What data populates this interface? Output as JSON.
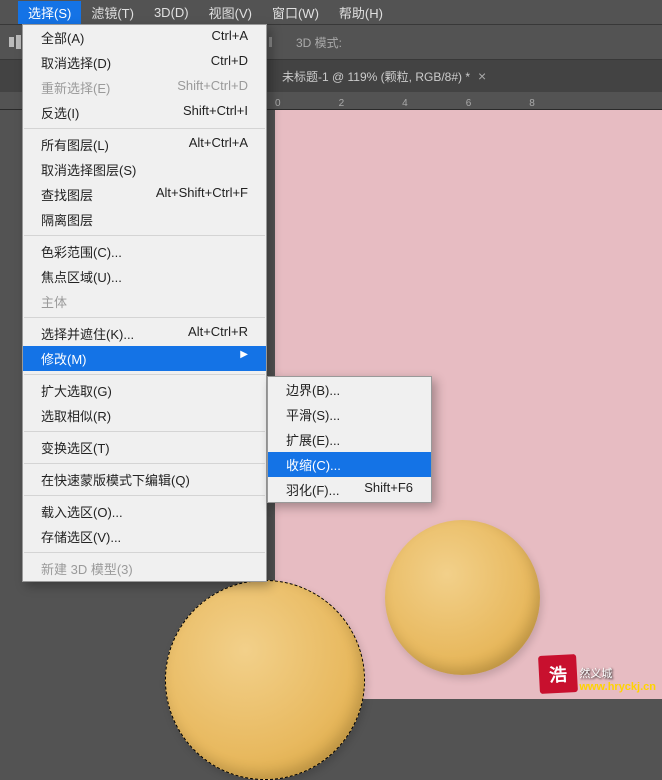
{
  "menubar": {
    "items": [
      "选择(S)",
      "滤镜(T)",
      "3D(D)",
      "视图(V)",
      "窗口(W)",
      "帮助(H)"
    ]
  },
  "toolbar": {
    "mode_label": "3D 模式:"
  },
  "tab": {
    "title": "未标题-1 @ 119% (颗粒, RGB/8#) *"
  },
  "ruler": {
    "marks": [
      "0",
      "2",
      "4",
      "6",
      "8"
    ]
  },
  "dropdown": {
    "all": {
      "label": "全部(A)",
      "shortcut": "Ctrl+A"
    },
    "deselect": {
      "label": "取消选择(D)",
      "shortcut": "Ctrl+D"
    },
    "reselect": {
      "label": "重新选择(E)",
      "shortcut": "Shift+Ctrl+D"
    },
    "inverse": {
      "label": "反选(I)",
      "shortcut": "Shift+Ctrl+I"
    },
    "all_layers": {
      "label": "所有图层(L)",
      "shortcut": "Alt+Ctrl+A"
    },
    "deselect_layers": {
      "label": "取消选择图层(S)",
      "shortcut": ""
    },
    "find_layers": {
      "label": "查找图层",
      "shortcut": "Alt+Shift+Ctrl+F"
    },
    "isolate_layers": {
      "label": "隔离图层",
      "shortcut": ""
    },
    "color_range": {
      "label": "色彩范围(C)...",
      "shortcut": ""
    },
    "focus_area": {
      "label": "焦点区域(U)...",
      "shortcut": ""
    },
    "subject": {
      "label": "主体",
      "shortcut": ""
    },
    "select_mask": {
      "label": "选择并遮住(K)...",
      "shortcut": "Alt+Ctrl+R"
    },
    "modify": {
      "label": "修改(M)",
      "shortcut": ""
    },
    "grow": {
      "label": "扩大选取(G)",
      "shortcut": ""
    },
    "similar": {
      "label": "选取相似(R)",
      "shortcut": ""
    },
    "transform": {
      "label": "变换选区(T)",
      "shortcut": ""
    },
    "quickmask": {
      "label": "在快速蒙版模式下编辑(Q)",
      "shortcut": ""
    },
    "load": {
      "label": "载入选区(O)...",
      "shortcut": ""
    },
    "save": {
      "label": "存储选区(V)...",
      "shortcut": ""
    },
    "new3d": {
      "label": "新建 3D 模型(3)",
      "shortcut": ""
    }
  },
  "submenu": {
    "border": {
      "label": "边界(B)...",
      "shortcut": ""
    },
    "smooth": {
      "label": "平滑(S)...",
      "shortcut": ""
    },
    "expand": {
      "label": "扩展(E)...",
      "shortcut": ""
    },
    "contract": {
      "label": "收缩(C)...",
      "shortcut": ""
    },
    "feather": {
      "label": "羽化(F)...",
      "shortcut": "Shift+F6"
    }
  },
  "watermark": {
    "box": "浩",
    "text": "然义城",
    "url": "www.hryckj.cn"
  }
}
